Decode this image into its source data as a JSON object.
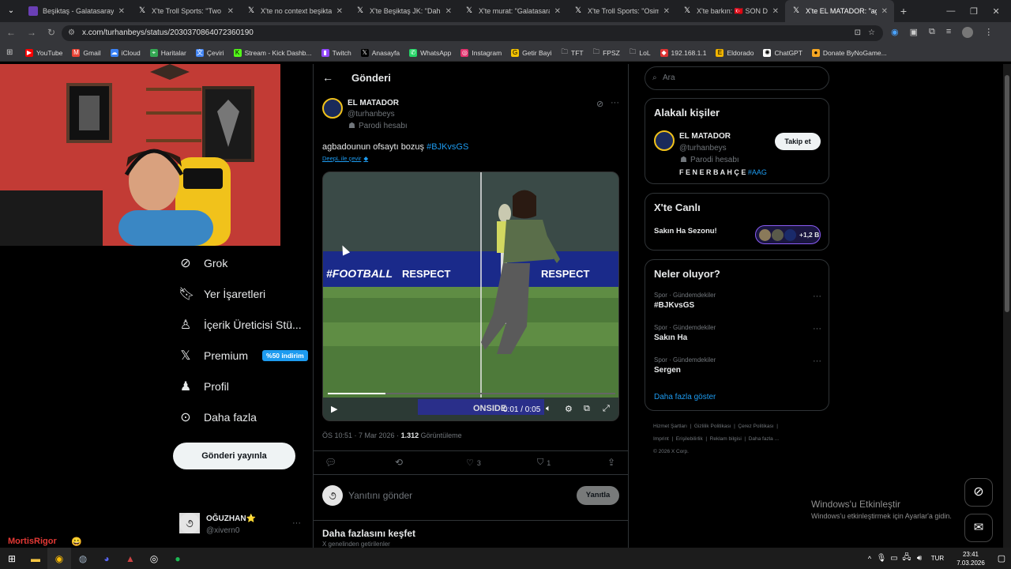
{
  "tabs": [
    {
      "label": "Beşiktaş - Galatasaray Ma",
      "icon": "news-icon"
    },
    {
      "label": "X'te Troll Sports: \"Two red",
      "icon": "x-icon"
    },
    {
      "label": "X'te no context beşiktaş:",
      "icon": "x-icon"
    },
    {
      "label": "X'te Beşiktaş JK: \"Daha ne",
      "icon": "x-icon"
    },
    {
      "label": "X'te murat: \"Galatasaraylı",
      "icon": "x-icon"
    },
    {
      "label": "X'te Troll Sports: \"Osimhe",
      "icon": "x-icon"
    },
    {
      "label": "X'te barkın: 🇹🇷 SON DAK",
      "icon": "x-icon"
    },
    {
      "label": "X'te EL MATADOR: \"agba",
      "icon": "x-icon"
    }
  ],
  "address": {
    "url": "x.com/turhanbeys/status/2030370864072360190"
  },
  "bookmarks": [
    "YouTube",
    "Gmail",
    "iCloud",
    "Haritalar",
    "Çeviri",
    "Stream - Kick Dashb...",
    "Twitch",
    "Anasayfa",
    "WhatsApp",
    "Instagram",
    "Getir Bayi",
    "TFT",
    "FPSZ",
    "LoL",
    "192.168.1.1",
    "Eldorado",
    "ChatGPT",
    "Donate ByNoGame..."
  ],
  "nav": {
    "items": [
      "Grok",
      "Yer İşaretleri",
      "İçerik Üreticisi Stü...",
      "Premium",
      "Profil",
      "Daha fazla"
    ],
    "premium_badge": "%50 indirim",
    "post_button": "Gönderi yayınla",
    "account_name": "OĞUZHAN⭐",
    "account_handle": "@xivern0"
  },
  "stream_overlay": {
    "name": "MortisRigor"
  },
  "post": {
    "header": "Gönderi",
    "author": "EL MATADOR",
    "handle": "@turhanbeys",
    "parody": "Parodi hesabı",
    "text": "agbadounun ofsaytı bozuş",
    "hashtag": "#BJKvsGS",
    "translate": "DeepL ile çevir",
    "video_time": "0:01 / 0:05",
    "video_progress": 0.2,
    "video_watermark": "ONSIDE",
    "banner_a": "#FOOTBALL",
    "banner_b": "RESPECT",
    "meta_time": "ÖS 10:51 · 7 Mar 2026 ·",
    "views": "1.312",
    "views_label": "Görüntüleme",
    "likes": "3",
    "bookmarks_count": "1",
    "reply_placeholder": "Yanıtını gönder",
    "reply_button": "Yanıtla",
    "explore_title": "Daha fazlasını keşfet",
    "explore_sub": "X genelinden getirilenler"
  },
  "right": {
    "search_placeholder": "Ara",
    "related_title": "Alakalı kişiler",
    "related_name": "EL MATADOR",
    "related_handle": "@turhanbeys",
    "related_parody": "Parodi hesabı",
    "related_bio": "F E N E R B A H Ç E",
    "related_bio_tag": "#AAG",
    "follow": "Takip et",
    "live_title": "X'te Canlı",
    "live_name": "Sakın Ha Sezonu!",
    "live_count": "+1,2 B",
    "trends_title": "Neler oluyor?",
    "trends": [
      {
        "cat": "Spor · Gündemdekiler",
        "name": "#BJKvsGS"
      },
      {
        "cat": "Spor · Gündemdekiler",
        "name": "Sakın Ha"
      },
      {
        "cat": "Spor · Gündemdekiler",
        "name": "Sergen"
      }
    ],
    "show_more": "Daha fazla göster",
    "footer_links": [
      "Hizmet Şartları",
      "Gizlilik Politikası",
      "Çerez Politikası",
      "Imprint",
      "Erişilebilirlik",
      "Reklam bilgisi",
      "Daha fazla ..."
    ],
    "copyright": "© 2026 X Corp."
  },
  "windows": {
    "activate_title": "Windows'u Etkinleştir",
    "activate_sub": "Windows'u etkinleştirmek için Ayarlar'a gidin."
  },
  "taskbar": {
    "lang": "TUR",
    "time": "23:41",
    "date": "7.03.2026"
  },
  "colors": {
    "accent": "#1d9bf0",
    "webcam_wall": "#c23b35",
    "premium_badge": "#1d9bf0"
  }
}
